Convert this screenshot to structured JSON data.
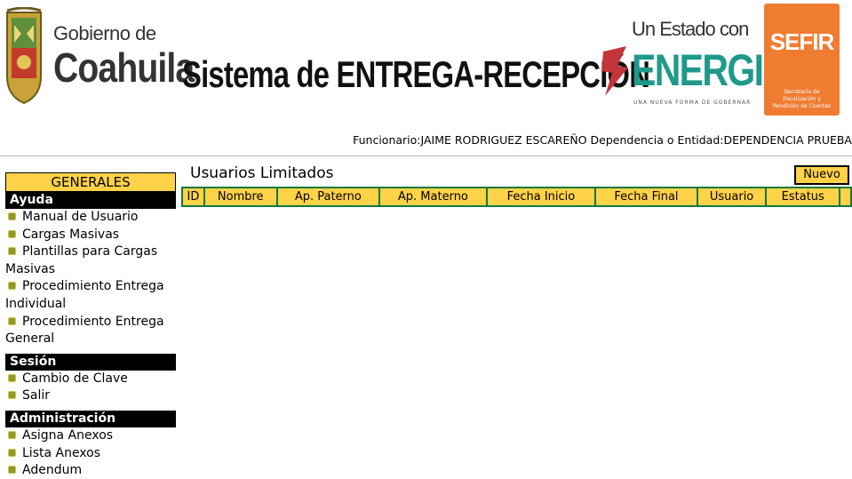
{
  "header": {
    "gov_small": "Gobierno de",
    "gov_big": "Coahuila",
    "system_title": "Sistema de ENTREGA-RECEPCIÓN",
    "slogan_top": "Un Estado con",
    "slogan_big": "ENERGIA",
    "slogan_tag": "UNA NUEVA FORMA DE GOBERNAR",
    "sefir_name": "SEFIR",
    "sefir_sub": "Secretaría de Fiscalización y Rendición de Cuentas",
    "brand_orange": "#f07c32",
    "brand_teal": "#1f9a8a"
  },
  "user_bar": {
    "funcionario_label": "Funcionario:",
    "funcionario_value": "JAIME RODRIGUEZ ESCAREÑO",
    "dependencia_label": " Dependencia o Entidad:",
    "dependencia_value": "DEPENDENCIA PRUEBA"
  },
  "sidebar": {
    "title": "GENERALES",
    "sections": [
      {
        "title": "Ayuda",
        "items": [
          "Manual de Usuario",
          "Cargas Masivas",
          "Plantillas para Cargas Masivas",
          "Procedimiento Entrega Individual",
          "Procedimiento Entrega General"
        ]
      },
      {
        "title": "Sesión",
        "items": [
          "Cambio de Clave",
          "Salir"
        ]
      },
      {
        "title": "Administración",
        "items": [
          "Asigna Anexos",
          "Lista Anexos",
          "Adendum"
        ]
      }
    ]
  },
  "main": {
    "title": "Usuarios Limitados",
    "new_button": "Nuevo",
    "columns": [
      "ID",
      "Nombre",
      "Ap. Paterno",
      "Ap. Materno",
      "Fecha Inicio",
      "Fecha Final",
      "Usuario",
      "Estatus",
      ""
    ],
    "accent_yellow": "#ffd247",
    "border_green": "#0d7a3e"
  }
}
